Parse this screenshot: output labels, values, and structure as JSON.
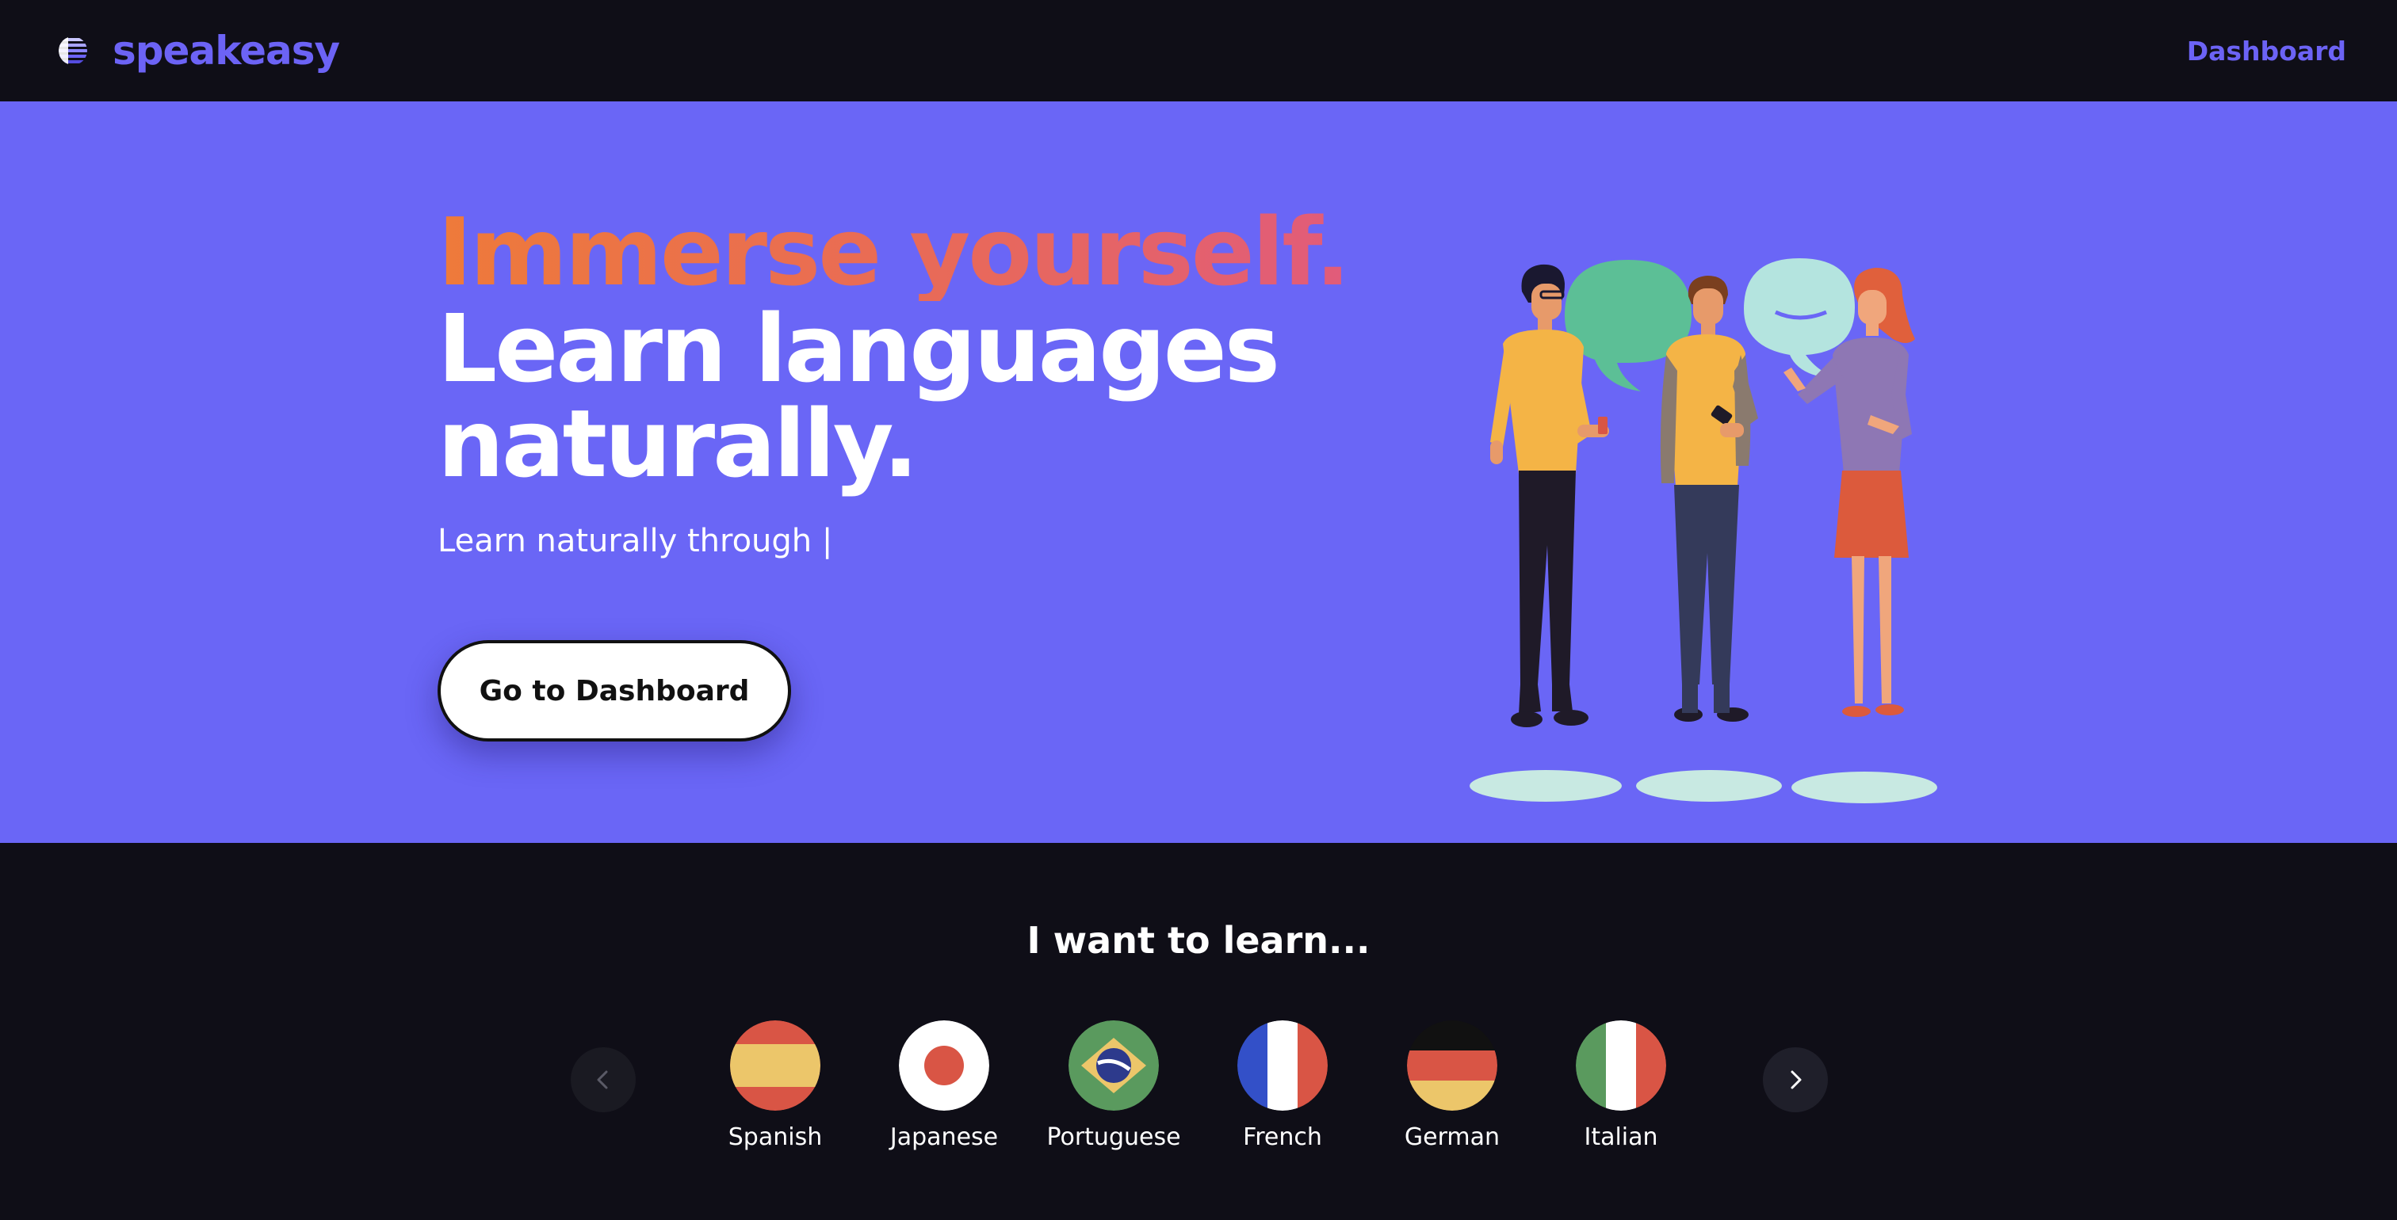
{
  "nav": {
    "brand": "speakeasy",
    "logo_icon": "striped-globe-icon",
    "dashboard_link": "Dashboard",
    "brand_color": "#6c63f5"
  },
  "hero": {
    "headline_accent": "Immerse yourself.",
    "headline_main": "Learn languages naturally.",
    "subtitle": "Learn naturally through |",
    "cta": "Go to Dashboard",
    "background_color": "#6a66f6",
    "illustration": "people-conversation-illustration"
  },
  "learn": {
    "title": "I want to learn...",
    "prev_icon": "chevron-left-icon",
    "next_icon": "chevron-right-icon",
    "languages": [
      {
        "label": "Spanish",
        "icon": "spain-flag-icon"
      },
      {
        "label": "Japanese",
        "icon": "japan-flag-icon"
      },
      {
        "label": "Portuguese",
        "icon": "brazil-flag-icon"
      },
      {
        "label": "French",
        "icon": "france-flag-icon"
      },
      {
        "label": "German",
        "icon": "germany-flag-icon"
      },
      {
        "label": "Italian",
        "icon": "italy-flag-icon"
      }
    ]
  }
}
